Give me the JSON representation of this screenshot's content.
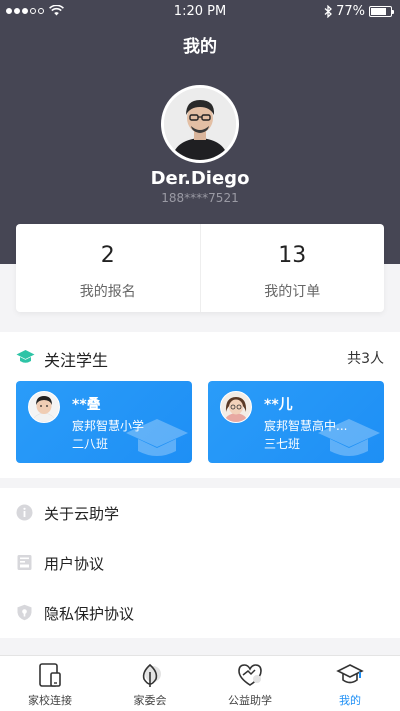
{
  "status_bar": {
    "time": "1:20 PM",
    "battery": "77%",
    "battery_level": 0.77
  },
  "header": {
    "title": "我的"
  },
  "profile": {
    "name": "Der.Diego",
    "phone": "188****7521"
  },
  "stats": [
    {
      "value": "2",
      "label": "我的报名"
    },
    {
      "value": "13",
      "label": "我的订单"
    }
  ],
  "follow": {
    "title": "关注学生",
    "count": "共3人",
    "students": [
      {
        "name": "**叠",
        "school": "宸邦智慧小学",
        "class": "二八班"
      },
      {
        "name": "**儿",
        "school": "宸邦智慧高中...",
        "class": "三七班"
      }
    ]
  },
  "menu": [
    {
      "label": "关于云助学",
      "icon": "info-icon"
    },
    {
      "label": "用户协议",
      "icon": "document-icon"
    },
    {
      "label": "隐私保护协议",
      "icon": "shield-icon"
    }
  ],
  "tabs": [
    {
      "label": "家校连接",
      "icon": "phone-book-icon"
    },
    {
      "label": "家委会",
      "icon": "leaf-icon"
    },
    {
      "label": "公益助学",
      "icon": "heart-hands-icon"
    },
    {
      "label": "我的",
      "icon": "graduation-cap-icon",
      "active": true
    }
  ],
  "colors": {
    "header_bg": "#464654",
    "accent": "#1e8ff5",
    "teal": "#2ec4a6"
  }
}
